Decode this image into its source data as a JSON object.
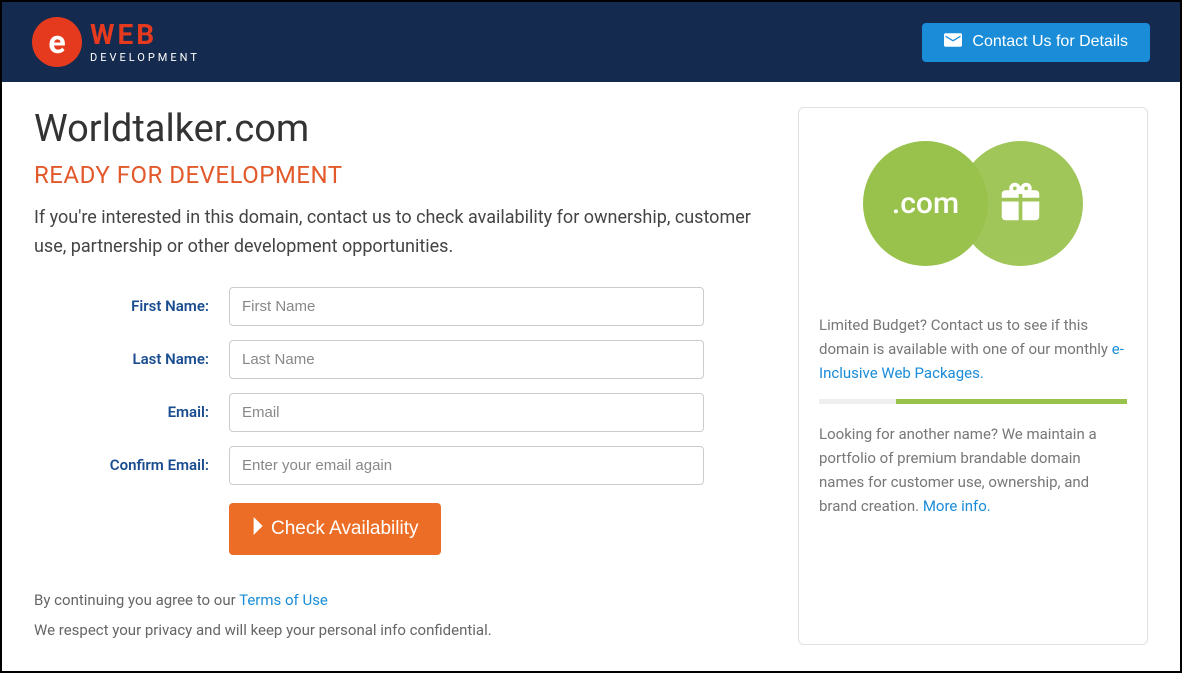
{
  "header": {
    "logo_web": "WEB",
    "logo_dev": "DEVELOPMENT",
    "contact_label": "Contact Us for Details"
  },
  "main": {
    "title": "Worldtalker.com",
    "subtitle": "READY FOR DEVELOPMENT",
    "intro": "If you're interested in this domain, contact us to check availability for ownership, customer use, partnership or other development opportunities."
  },
  "form": {
    "first_name": {
      "label": "First Name:",
      "placeholder": "First Name"
    },
    "last_name": {
      "label": "Last Name:",
      "placeholder": "Last Name"
    },
    "email": {
      "label": "Email:",
      "placeholder": "Email"
    },
    "confirm_email": {
      "label": "Confirm Email:",
      "placeholder": "Enter your email again"
    },
    "submit_label": "Check Availability"
  },
  "footer": {
    "agree_prefix": "By continuing you agree to our ",
    "terms_link": "Terms of Use",
    "privacy": "We respect your privacy and will keep your personal info confidential."
  },
  "sidebar": {
    "com_label": ".com",
    "budget_text": "Limited Budget? Contact us to see if this domain is available with one of our monthly ",
    "packages_link": "e-Inclusive Web Packages.",
    "portfolio_text": "Looking for another name? We maintain a portfolio of premium brandable domain names for customer use, ownership, and brand creation. ",
    "more_info_link": "More info."
  }
}
